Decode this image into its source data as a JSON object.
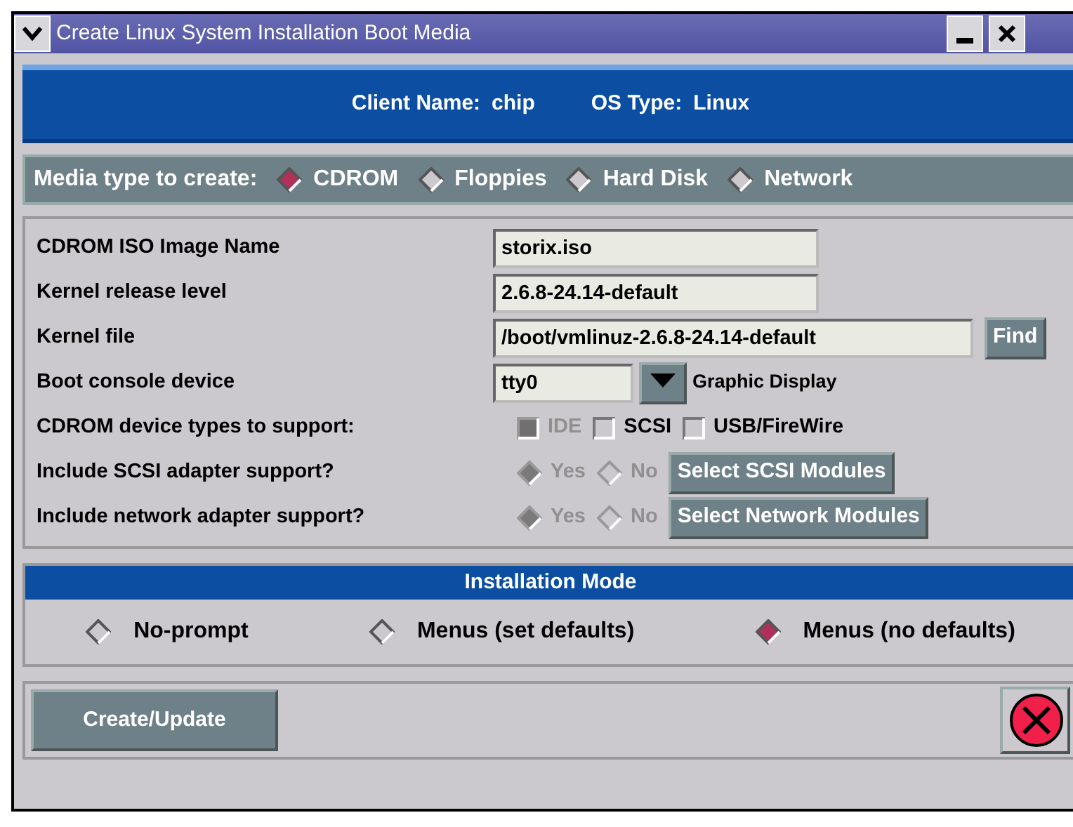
{
  "window": {
    "title": "Create Linux System Installation Boot Media"
  },
  "header": {
    "client_label": "Client Name:",
    "client_value": "chip",
    "os_label": "OS Type:",
    "os_value": "Linux"
  },
  "media": {
    "label": "Media type to create:",
    "options": [
      {
        "label": "CDROM",
        "selected": true
      },
      {
        "label": "Floppies",
        "selected": false
      },
      {
        "label": "Hard Disk",
        "selected": false
      },
      {
        "label": "Network",
        "selected": false
      }
    ]
  },
  "fields": [
    {
      "kind": "text",
      "label": "CDROM ISO Image Name",
      "value": "storix.iso"
    },
    {
      "kind": "text",
      "label": "Kernel release level",
      "value": "2.6.8-24.14-default"
    },
    {
      "kind": "file",
      "label": "Kernel file",
      "value": "/boot/vmlinuz-2.6.8-24.14-default",
      "button": "Find"
    },
    {
      "kind": "combo",
      "label": "Boot console device",
      "value": "tty0",
      "display": "Graphic Display"
    },
    {
      "kind": "checks",
      "label": "CDROM device types to support:",
      "options": [
        {
          "label": "IDE",
          "checked": true,
          "disabled": true
        },
        {
          "label": "SCSI",
          "checked": false,
          "disabled": false
        },
        {
          "label": "USB/FireWire",
          "checked": false,
          "disabled": false
        }
      ]
    },
    {
      "kind": "radios",
      "label": "Include SCSI adapter support?",
      "button": "Select SCSI Modules",
      "options": [
        {
          "label": "Yes",
          "selected": true,
          "disabled": true
        },
        {
          "label": "No",
          "selected": false,
          "disabled": true
        }
      ]
    },
    {
      "kind": "radios",
      "label": "Include network adapter support?",
      "button": "Select Network Modules",
      "options": [
        {
          "label": "Yes",
          "selected": true,
          "disabled": true
        },
        {
          "label": "No",
          "selected": false,
          "disabled": true
        }
      ]
    }
  ],
  "install_mode": {
    "title": "Installation Mode",
    "options": [
      {
        "label": "No-prompt",
        "selected": false
      },
      {
        "label": "Menus (set defaults)",
        "selected": false
      },
      {
        "label": "Menus (no defaults)",
        "selected": true
      }
    ]
  },
  "buttons": {
    "create": "Create/Update"
  }
}
